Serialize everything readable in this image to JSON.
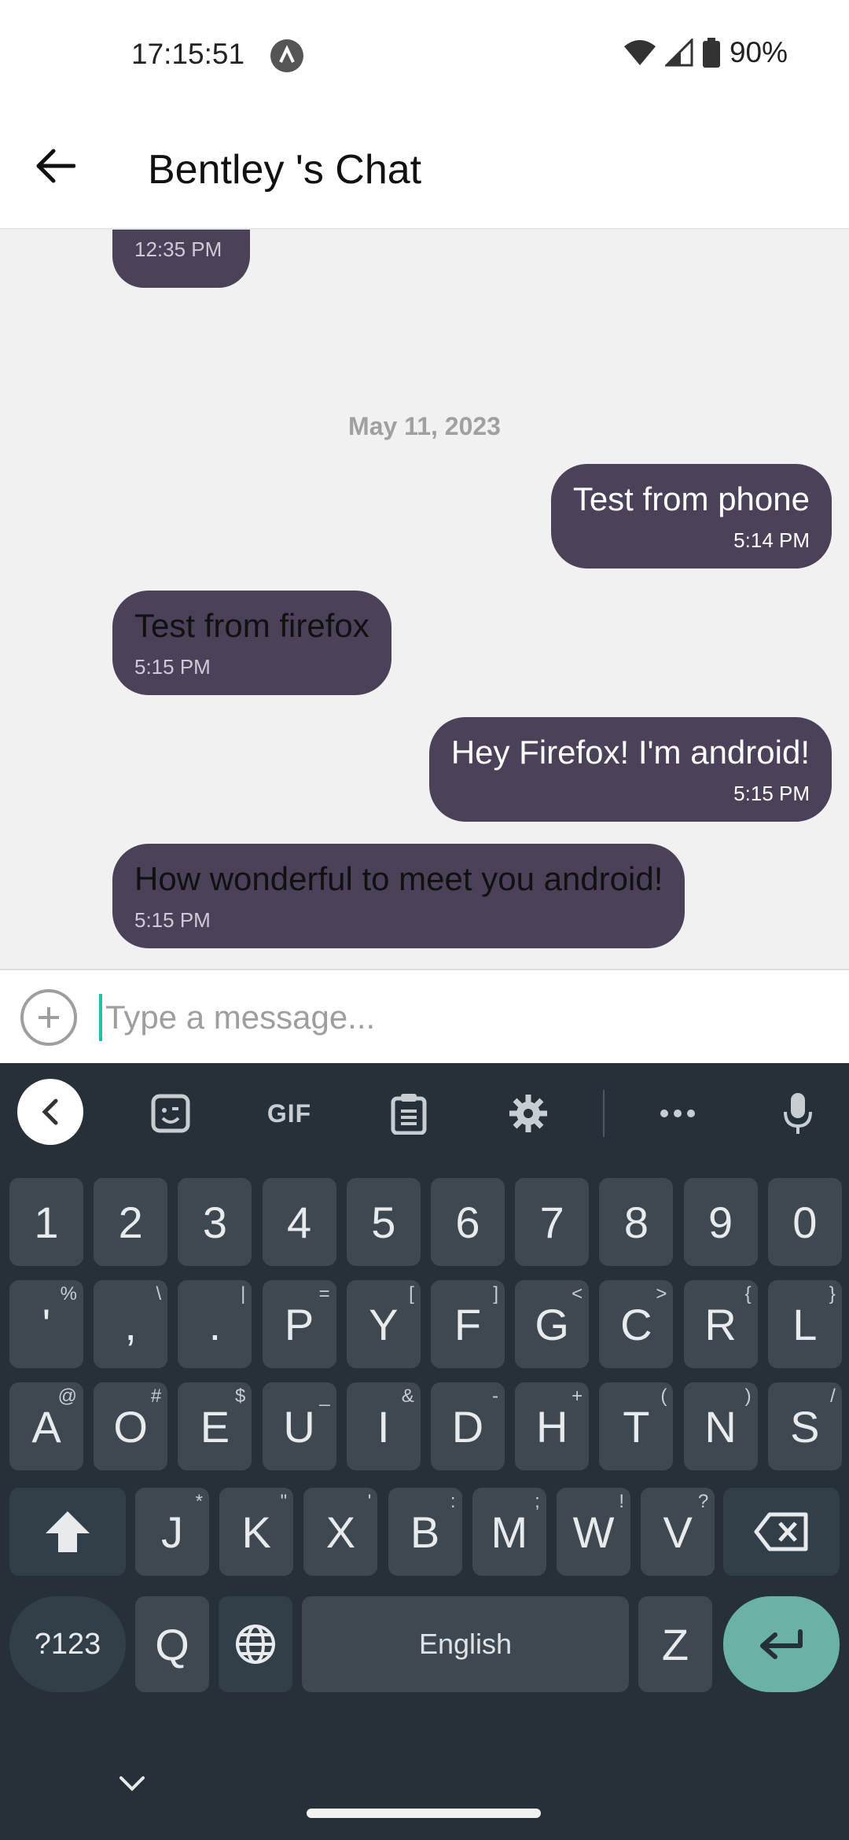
{
  "status_bar": {
    "time": "17:15:51",
    "battery": "90%",
    "icons": [
      "app-notification-icon",
      "wifi-icon",
      "cell-signal-icon",
      "battery-icon"
    ]
  },
  "app_bar": {
    "title": "Bentley 's Chat",
    "back_icon": "arrow-left-icon"
  },
  "chat": {
    "partial_message": {
      "time": "12:35 PM",
      "direction": "received"
    },
    "date_separator": "May 11, 2023",
    "messages": [
      {
        "text": "Test from phone",
        "time": "5:14 PM",
        "direction": "sent"
      },
      {
        "text": "Test from firefox",
        "time": "5:15 PM",
        "direction": "received"
      },
      {
        "text": "Hey Firefox! I'm android!",
        "time": "5:15 PM",
        "direction": "sent"
      },
      {
        "text": "How wonderful to meet you android!",
        "time": "5:15 PM",
        "direction": "received"
      }
    ]
  },
  "input": {
    "placeholder": "Type a message...",
    "value": "",
    "add_icon": "plus-circle-icon"
  },
  "keyboard": {
    "toolbar": [
      "chevron-left-icon",
      "sticker-icon",
      "GIF",
      "clipboard-icon",
      "gear-icon",
      "more-icon",
      "microphone-icon"
    ],
    "gif_label": "GIF",
    "number_row": [
      "1",
      "2",
      "3",
      "4",
      "5",
      "6",
      "7",
      "8",
      "9",
      "0"
    ],
    "row1": [
      {
        "k": "'",
        "h": "%"
      },
      {
        "k": ",",
        "h": "\\"
      },
      {
        "k": ".",
        "h": "|"
      },
      {
        "k": "P",
        "h": "="
      },
      {
        "k": "Y",
        "h": "["
      },
      {
        "k": "F",
        "h": "]"
      },
      {
        "k": "G",
        "h": "<"
      },
      {
        "k": "C",
        "h": ">"
      },
      {
        "k": "R",
        "h": "{"
      },
      {
        "k": "L",
        "h": "}"
      }
    ],
    "row2": [
      {
        "k": "A",
        "h": "@"
      },
      {
        "k": "O",
        "h": "#"
      },
      {
        "k": "E",
        "h": "$"
      },
      {
        "k": "U",
        "h": "_"
      },
      {
        "k": "I",
        "h": "&"
      },
      {
        "k": "D",
        "h": "-"
      },
      {
        "k": "H",
        "h": "+"
      },
      {
        "k": "T",
        "h": "("
      },
      {
        "k": "N",
        "h": ")"
      },
      {
        "k": "S",
        "h": "/"
      }
    ],
    "row3": [
      {
        "k": "J",
        "h": "*"
      },
      {
        "k": "K",
        "h": "\""
      },
      {
        "k": "X",
        "h": "'"
      },
      {
        "k": "B",
        "h": ":"
      },
      {
        "k": "M",
        "h": ";"
      },
      {
        "k": "W",
        "h": "!"
      },
      {
        "k": "V",
        "h": "?"
      }
    ],
    "symbols_label": "?123",
    "q_key": "Q",
    "space_label": "English",
    "z_key": "Z"
  }
}
